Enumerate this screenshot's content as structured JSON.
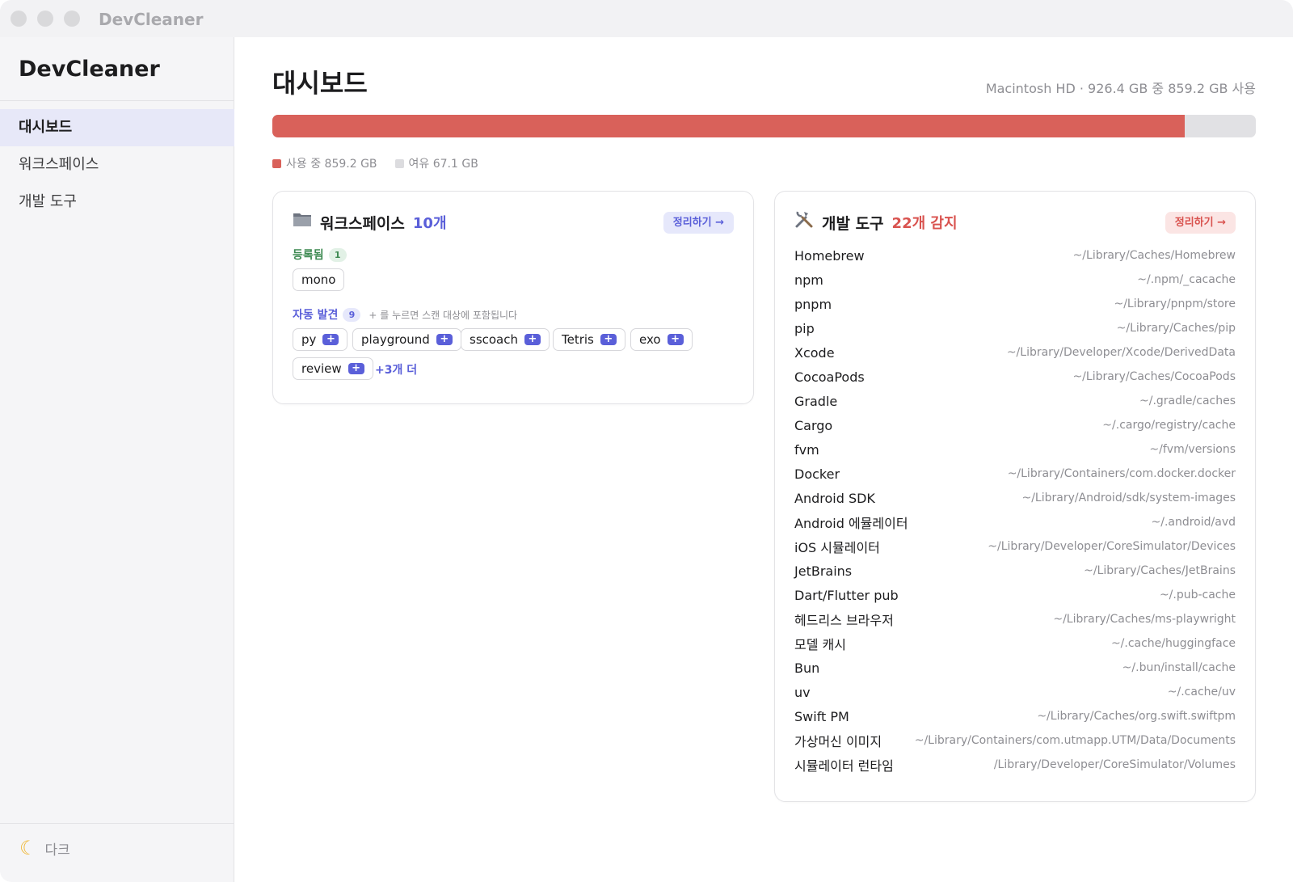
{
  "window": {
    "title": "DevCleaner"
  },
  "sidebar": {
    "brand": "DevCleaner",
    "items": [
      {
        "label": "대시보드",
        "active": true
      },
      {
        "label": "워크스페이스",
        "active": false
      },
      {
        "label": "개발 도구",
        "active": false
      }
    ],
    "theme_label": "다크",
    "theme_icon": "moon-icon"
  },
  "header": {
    "title": "대시보드",
    "disk_info": "Macintosh HD · 926.4 GB 중 859.2 GB 사용"
  },
  "usage": {
    "used_fraction": 0.9275,
    "used_label": "사용 중 859.2 GB",
    "free_label": "여유 67.1 GB",
    "colors": {
      "used": "#d9615a",
      "free": "#e1e1e4",
      "accent": "#5a5fd9",
      "danger": "#d9534f"
    }
  },
  "workspace_card": {
    "icon": "folder-icon",
    "title": "워크스페이스",
    "count": "10개",
    "clean_label": "정리하기 →",
    "registered_label": "등록됨",
    "registered_count": "1",
    "registered_items": [
      "mono"
    ],
    "auto_label": "자동 발견",
    "auto_count": "9",
    "auto_hint": "+ 를 누르면 스캔 대상에 포함됩니다",
    "auto_items": [
      "py",
      "playground",
      "sscoach",
      "Tetris",
      "exo",
      "review"
    ],
    "plus_label": "+",
    "more_label": "+3개 더"
  },
  "devtools_card": {
    "icon": "tools-icon",
    "title": "개발 도구",
    "count": "22개 감지",
    "clean_label": "정리하기 →",
    "tools": [
      {
        "name": "Homebrew",
        "path": "~/Library/Caches/Homebrew"
      },
      {
        "name": "npm",
        "path": "~/.npm/_cacache"
      },
      {
        "name": "pnpm",
        "path": "~/Library/pnpm/store"
      },
      {
        "name": "pip",
        "path": "~/Library/Caches/pip"
      },
      {
        "name": "Xcode",
        "path": "~/Library/Developer/Xcode/DerivedData"
      },
      {
        "name": "CocoaPods",
        "path": "~/Library/Caches/CocoaPods"
      },
      {
        "name": "Gradle",
        "path": "~/.gradle/caches"
      },
      {
        "name": "Cargo",
        "path": "~/.cargo/registry/cache"
      },
      {
        "name": "fvm",
        "path": "~/fvm/versions"
      },
      {
        "name": "Docker",
        "path": "~/Library/Containers/com.docker.docker"
      },
      {
        "name": "Android SDK",
        "path": "~/Library/Android/sdk/system-images"
      },
      {
        "name": "Android 에뮬레이터",
        "path": "~/.android/avd"
      },
      {
        "name": "iOS 시뮬레이터",
        "path": "~/Library/Developer/CoreSimulator/Devices"
      },
      {
        "name": "JetBrains",
        "path": "~/Library/Caches/JetBrains"
      },
      {
        "name": "Dart/Flutter pub",
        "path": "~/.pub-cache"
      },
      {
        "name": "헤드리스 브라우저",
        "path": "~/Library/Caches/ms-playwright"
      },
      {
        "name": "모델 캐시",
        "path": "~/.cache/huggingface"
      },
      {
        "name": "Bun",
        "path": "~/.bun/install/cache"
      },
      {
        "name": "uv",
        "path": "~/.cache/uv"
      },
      {
        "name": "Swift PM",
        "path": "~/Library/Caches/org.swift.swiftpm"
      },
      {
        "name": "가상머신 이미지",
        "path": "~/Library/Containers/com.utmapp.UTM/Data/Documents"
      },
      {
        "name": "시뮬레이터 런타임",
        "path": "/Library/Developer/CoreSimulator/Volumes"
      }
    ]
  }
}
